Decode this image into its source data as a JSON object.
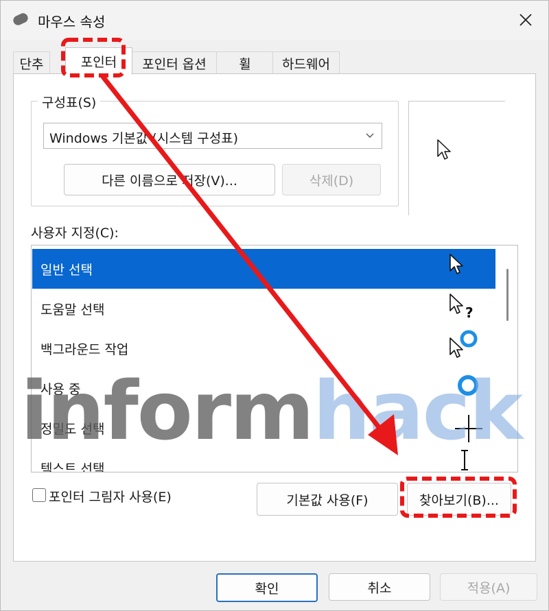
{
  "window": {
    "title": "마우스 속성"
  },
  "tabs": [
    {
      "label": "단추",
      "active": false
    },
    {
      "label": "포인터",
      "active": true
    },
    {
      "label": "포인터 옵션",
      "active": false
    },
    {
      "label": "휠",
      "active": false
    },
    {
      "label": "하드웨어",
      "active": false
    }
  ],
  "scheme": {
    "group_label": "구성표(S)",
    "selected_value": "Windows 기본값 (시스템 구성표)",
    "save_as_label": "다른 이름으로 저장(V)...",
    "delete_label": "삭제(D)"
  },
  "customize": {
    "label": "사용자 지정(C):",
    "items": [
      {
        "label": "일반 선택",
        "icon": "arrow-cursor-icon",
        "selected": true
      },
      {
        "label": "도움말 선택",
        "icon": "help-select-cursor-icon",
        "selected": false
      },
      {
        "label": "백그라운드 작업",
        "icon": "working-in-background-cursor-icon",
        "selected": false
      },
      {
        "label": "사용 중",
        "icon": "busy-cursor-icon",
        "selected": false
      },
      {
        "label": "정밀도 선택",
        "icon": "crosshair-cursor-icon",
        "selected": false
      },
      {
        "label": "텍스트 선택",
        "icon": "text-beam-cursor-icon",
        "selected": false
      }
    ]
  },
  "shadow_checkbox": {
    "label": "포인터 그림자 사용(E)",
    "checked": false
  },
  "use_default_label": "기본값 사용(F)",
  "browse_label": "찾아보기(B)...",
  "footer": {
    "ok_label": "확인",
    "cancel_label": "취소",
    "apply_label": "적용(A)"
  },
  "watermark": {
    "part1": "inform",
    "part2": "hack"
  },
  "colors": {
    "selection": "#0867d0",
    "annotation": "#e8191a",
    "accent_focus": "#2b6fbd"
  }
}
